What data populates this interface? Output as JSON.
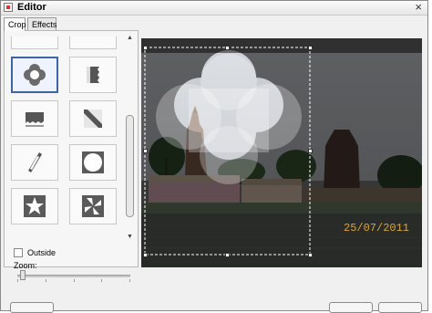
{
  "window": {
    "title": "Editor",
    "close_glyph": "×"
  },
  "tabs": [
    {
      "label": "Crop",
      "active": true
    },
    {
      "label": "Effects",
      "active": false
    }
  ],
  "crop_panel": {
    "shapes": [
      {
        "icon": "rect-top-edge-icon"
      },
      {
        "icon": "ornate-frame-top-icon"
      },
      {
        "icon": "flower-icon",
        "selected": true
      },
      {
        "icon": "torn-edge-right-icon"
      },
      {
        "icon": "torn-edge-bottom-icon"
      },
      {
        "icon": "diagonal-strip-icon"
      },
      {
        "icon": "slash-icon"
      },
      {
        "icon": "circle-icon"
      },
      {
        "icon": "star-icon"
      },
      {
        "icon": "four-leaf-icon"
      }
    ],
    "outside_label": "Outside",
    "outside_checked": false,
    "zoom_label": "Zoom:",
    "zoom_level": 0.05
  },
  "preview": {
    "date_stamp": "25/07/2011"
  },
  "buttons": [
    "",
    "",
    ""
  ]
}
